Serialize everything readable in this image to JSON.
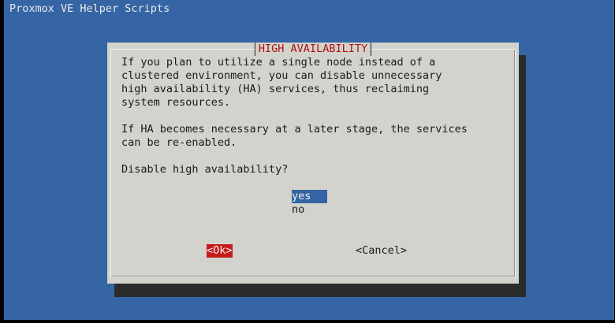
{
  "backtitle": "Proxmox VE Helper Scripts",
  "dialog": {
    "title": "HIGH AVAILABILITY",
    "message_lines": [
      "If you plan to utilize a single node instead of a",
      "clustered environment, you can disable unnecessary",
      "high availability (HA) services, thus reclaiming",
      "system resources.",
      "",
      "If HA becomes necessary at a later stage, the services",
      "can be re-enabled."
    ],
    "question": "Disable high availability?",
    "options": [
      {
        "label": "yes",
        "selected": true
      },
      {
        "label": "no",
        "selected": false
      }
    ],
    "buttons": {
      "ok_label": "<Ok>",
      "cancel_label": "<Cancel>"
    }
  },
  "colors": {
    "background": "#3565a5",
    "dialog": "#d3d3cd",
    "title": "#b01010",
    "focused_button": "#c61a1a",
    "selected_option": "#3565a5"
  }
}
